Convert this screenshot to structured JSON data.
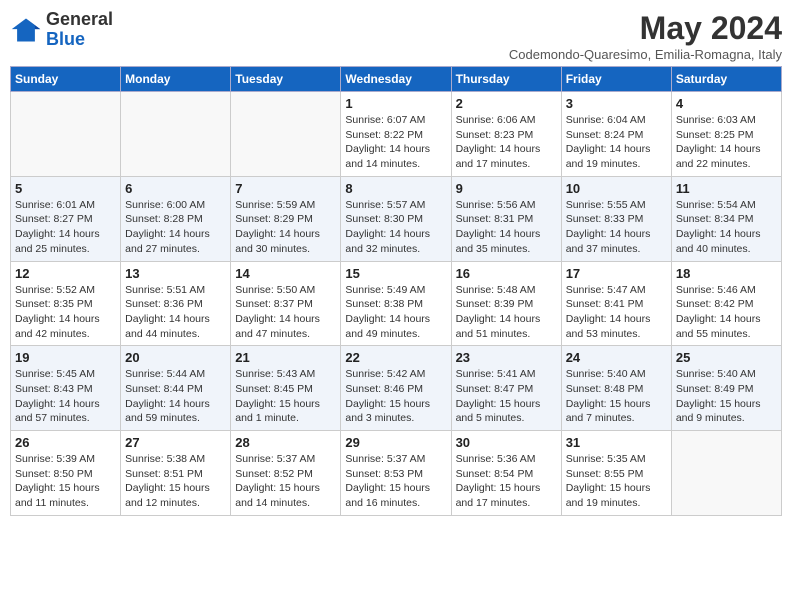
{
  "header": {
    "logo_general": "General",
    "logo_blue": "Blue",
    "month_year": "May 2024",
    "location": "Codemondo-Quaresimo, Emilia-Romagna, Italy"
  },
  "weekdays": [
    "Sunday",
    "Monday",
    "Tuesday",
    "Wednesday",
    "Thursday",
    "Friday",
    "Saturday"
  ],
  "weeks": [
    [
      {
        "day": "",
        "info": ""
      },
      {
        "day": "",
        "info": ""
      },
      {
        "day": "",
        "info": ""
      },
      {
        "day": "1",
        "info": "Sunrise: 6:07 AM\nSunset: 8:22 PM\nDaylight: 14 hours\nand 14 minutes."
      },
      {
        "day": "2",
        "info": "Sunrise: 6:06 AM\nSunset: 8:23 PM\nDaylight: 14 hours\nand 17 minutes."
      },
      {
        "day": "3",
        "info": "Sunrise: 6:04 AM\nSunset: 8:24 PM\nDaylight: 14 hours\nand 19 minutes."
      },
      {
        "day": "4",
        "info": "Sunrise: 6:03 AM\nSunset: 8:25 PM\nDaylight: 14 hours\nand 22 minutes."
      }
    ],
    [
      {
        "day": "5",
        "info": "Sunrise: 6:01 AM\nSunset: 8:27 PM\nDaylight: 14 hours\nand 25 minutes."
      },
      {
        "day": "6",
        "info": "Sunrise: 6:00 AM\nSunset: 8:28 PM\nDaylight: 14 hours\nand 27 minutes."
      },
      {
        "day": "7",
        "info": "Sunrise: 5:59 AM\nSunset: 8:29 PM\nDaylight: 14 hours\nand 30 minutes."
      },
      {
        "day": "8",
        "info": "Sunrise: 5:57 AM\nSunset: 8:30 PM\nDaylight: 14 hours\nand 32 minutes."
      },
      {
        "day": "9",
        "info": "Sunrise: 5:56 AM\nSunset: 8:31 PM\nDaylight: 14 hours\nand 35 minutes."
      },
      {
        "day": "10",
        "info": "Sunrise: 5:55 AM\nSunset: 8:33 PM\nDaylight: 14 hours\nand 37 minutes."
      },
      {
        "day": "11",
        "info": "Sunrise: 5:54 AM\nSunset: 8:34 PM\nDaylight: 14 hours\nand 40 minutes."
      }
    ],
    [
      {
        "day": "12",
        "info": "Sunrise: 5:52 AM\nSunset: 8:35 PM\nDaylight: 14 hours\nand 42 minutes."
      },
      {
        "day": "13",
        "info": "Sunrise: 5:51 AM\nSunset: 8:36 PM\nDaylight: 14 hours\nand 44 minutes."
      },
      {
        "day": "14",
        "info": "Sunrise: 5:50 AM\nSunset: 8:37 PM\nDaylight: 14 hours\nand 47 minutes."
      },
      {
        "day": "15",
        "info": "Sunrise: 5:49 AM\nSunset: 8:38 PM\nDaylight: 14 hours\nand 49 minutes."
      },
      {
        "day": "16",
        "info": "Sunrise: 5:48 AM\nSunset: 8:39 PM\nDaylight: 14 hours\nand 51 minutes."
      },
      {
        "day": "17",
        "info": "Sunrise: 5:47 AM\nSunset: 8:41 PM\nDaylight: 14 hours\nand 53 minutes."
      },
      {
        "day": "18",
        "info": "Sunrise: 5:46 AM\nSunset: 8:42 PM\nDaylight: 14 hours\nand 55 minutes."
      }
    ],
    [
      {
        "day": "19",
        "info": "Sunrise: 5:45 AM\nSunset: 8:43 PM\nDaylight: 14 hours\nand 57 minutes."
      },
      {
        "day": "20",
        "info": "Sunrise: 5:44 AM\nSunset: 8:44 PM\nDaylight: 14 hours\nand 59 minutes."
      },
      {
        "day": "21",
        "info": "Sunrise: 5:43 AM\nSunset: 8:45 PM\nDaylight: 15 hours\nand 1 minute."
      },
      {
        "day": "22",
        "info": "Sunrise: 5:42 AM\nSunset: 8:46 PM\nDaylight: 15 hours\nand 3 minutes."
      },
      {
        "day": "23",
        "info": "Sunrise: 5:41 AM\nSunset: 8:47 PM\nDaylight: 15 hours\nand 5 minutes."
      },
      {
        "day": "24",
        "info": "Sunrise: 5:40 AM\nSunset: 8:48 PM\nDaylight: 15 hours\nand 7 minutes."
      },
      {
        "day": "25",
        "info": "Sunrise: 5:40 AM\nSunset: 8:49 PM\nDaylight: 15 hours\nand 9 minutes."
      }
    ],
    [
      {
        "day": "26",
        "info": "Sunrise: 5:39 AM\nSunset: 8:50 PM\nDaylight: 15 hours\nand 11 minutes."
      },
      {
        "day": "27",
        "info": "Sunrise: 5:38 AM\nSunset: 8:51 PM\nDaylight: 15 hours\nand 12 minutes."
      },
      {
        "day": "28",
        "info": "Sunrise: 5:37 AM\nSunset: 8:52 PM\nDaylight: 15 hours\nand 14 minutes."
      },
      {
        "day": "29",
        "info": "Sunrise: 5:37 AM\nSunset: 8:53 PM\nDaylight: 15 hours\nand 16 minutes."
      },
      {
        "day": "30",
        "info": "Sunrise: 5:36 AM\nSunset: 8:54 PM\nDaylight: 15 hours\nand 17 minutes."
      },
      {
        "day": "31",
        "info": "Sunrise: 5:35 AM\nSunset: 8:55 PM\nDaylight: 15 hours\nand 19 minutes."
      },
      {
        "day": "",
        "info": ""
      }
    ]
  ]
}
